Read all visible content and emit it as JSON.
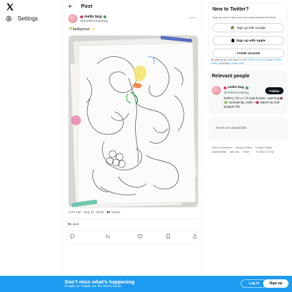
{
  "nav": {
    "logo_icon": "x-logo-icon",
    "settings_label": "Settings",
    "settings_icon": "gear-icon"
  },
  "post": {
    "header_title": "Post",
    "author_name": "mello bug",
    "author_handle": "@mellohumanbug",
    "text": "🌱bellsprout ✨",
    "time": "1:47 AM · Sep 27, 2023",
    "views_count": "67",
    "views_label": "Views",
    "likes_count": "5",
    "likes_label": "Likes"
  },
  "sidebar": {
    "new_title": "New to Twitter?",
    "new_subtitle": "Sign up now to get your own personalized timeline!",
    "google_label": "Sign up with Google",
    "apple_label": "Sign up with Apple",
    "create_label": "Create account",
    "terms_prefix": "By signing up, you agree to the ",
    "terms_link": "Terms of Service",
    "terms_mid": " and ",
    "privacy_link": "Privacy Policy",
    "terms_suffix": ", including ",
    "cookie_link": "Cookie Use",
    "terms_end": ".",
    "relevant_title": "Relevant people",
    "rel_name": "mello bug",
    "rel_handle": "@mellohumanbug",
    "follow_label": "Follow",
    "rel_bio": "he/him | ᕙ(⇀‸↼‶)ᕗ part-human---part-bug🐞🌿 consistently_mello ~🌺 watch my club penguin film",
    "trends_text": "Trends are unavailable.",
    "footer": [
      "Terms of Service",
      "Privacy Policy",
      "Cookie Policy",
      "Accessibility",
      "Ads info",
      "More ···",
      "© 2023 X Corp."
    ]
  },
  "bottom": {
    "title": "Don’t miss what’s happening",
    "subtitle": "People on Twitter are the first to know.",
    "login_label": "Log in",
    "signup_label": "Sign up"
  },
  "colors": {
    "accent": "#1d9bf0",
    "text": "#0f1419",
    "muted": "#536471"
  }
}
